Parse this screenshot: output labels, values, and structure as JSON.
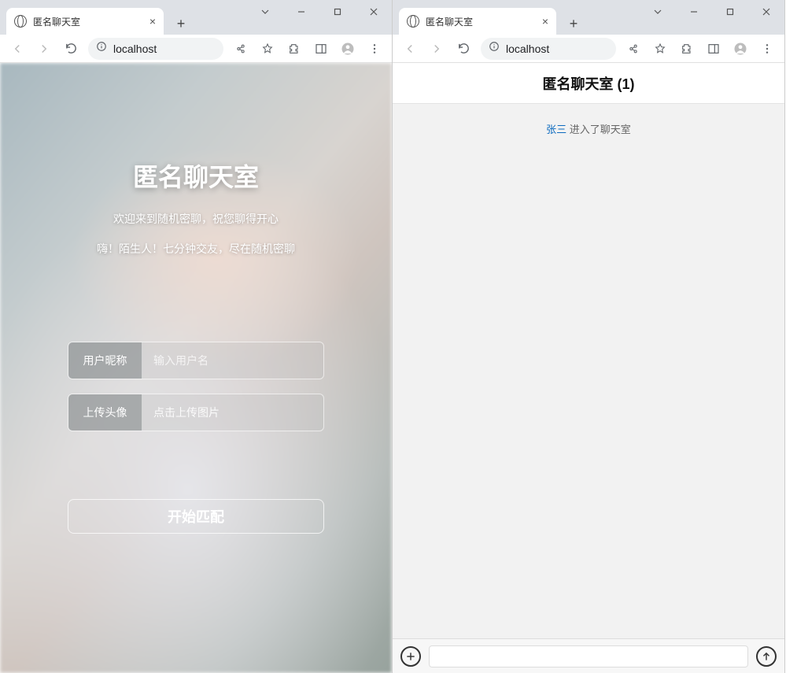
{
  "left": {
    "tab_title": "匿名聊天室",
    "url": "localhost",
    "title": "匿名聊天室",
    "subtitle1": "欢迎来到随机密聊，祝您聊得开心",
    "subtitle2": "嗨！陌生人！七分钟交友，尽在随机密聊",
    "nickname_label": "用户昵称",
    "nickname_placeholder": "输入用户名",
    "avatar_label": "上传头像",
    "avatar_hint": "点击上传图片",
    "start_button": "开始匹配"
  },
  "right": {
    "tab_title": "匿名聊天室",
    "url": "localhost",
    "header": "匿名聊天室 (1)",
    "sys_user": "张三",
    "sys_text": " 进入了聊天室",
    "input_placeholder": ""
  }
}
